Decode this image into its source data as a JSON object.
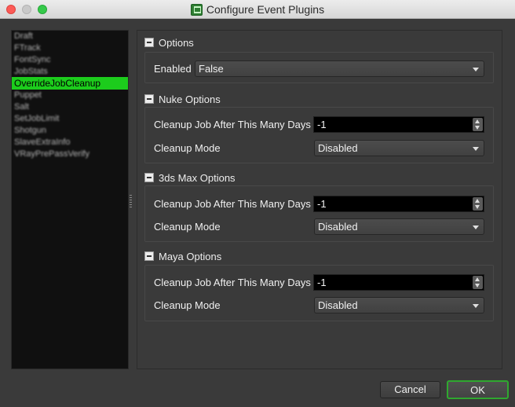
{
  "window": {
    "title": "Configure Event Plugins"
  },
  "plugin_list": [
    {
      "label": "Draft",
      "obscured": true
    },
    {
      "label": "FTrack",
      "obscured": true
    },
    {
      "label": "FontSync",
      "obscured": true
    },
    {
      "label": "JobStats",
      "obscured": true
    },
    {
      "label": "OverrideJobCleanup",
      "selected": true
    },
    {
      "label": "Puppet",
      "obscured": true
    },
    {
      "label": "Salt",
      "obscured": true
    },
    {
      "label": "SetJobLimit",
      "obscured": true
    },
    {
      "label": "Shotgun",
      "obscured": true
    },
    {
      "label": "SlaveExtraInfo",
      "obscured": true
    },
    {
      "label": "VRayPrePassVerify",
      "obscured": true
    }
  ],
  "groups": [
    {
      "title": "Options",
      "rows": [
        {
          "label": "Enabled",
          "control": "select",
          "value": "False"
        }
      ]
    },
    {
      "title": "Nuke Options",
      "rows": [
        {
          "label": "Cleanup Job After This Many Days",
          "control": "spinbox",
          "value": "-1"
        },
        {
          "label": "Cleanup Mode",
          "control": "select",
          "value": "Disabled"
        }
      ]
    },
    {
      "title": "3ds Max Options",
      "rows": [
        {
          "label": "Cleanup Job After This Many Days",
          "control": "spinbox",
          "value": "-1"
        },
        {
          "label": "Cleanup Mode",
          "control": "select",
          "value": "Disabled"
        }
      ]
    },
    {
      "title": "Maya Options",
      "rows": [
        {
          "label": "Cleanup Job After This Many Days",
          "control": "spinbox",
          "value": "-1"
        },
        {
          "label": "Cleanup Mode",
          "control": "select",
          "value": "Disabled"
        }
      ]
    }
  ],
  "buttons": {
    "cancel": "Cancel",
    "ok": "OK"
  },
  "icons": {
    "app": "deadline-monitor-icon",
    "collapse": "collapse-minus-icon",
    "dropdown": "chevron-down-icon",
    "spin_up": "arrow-up-icon",
    "spin_down": "arrow-down-icon"
  },
  "colors": {
    "selection": "#1ccc1c",
    "ok_border": "#2fa82f",
    "list_background": "#101010",
    "window_background": "#3a3a3a"
  }
}
